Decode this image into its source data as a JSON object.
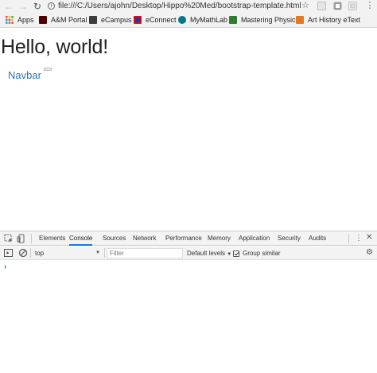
{
  "browser": {
    "url": "file:///C:/Users/ajohn/Desktop/Hippo%20Med/bootstrap-template.html",
    "bookmarks": [
      {
        "label": "Apps",
        "icon": "apps-grid-icon",
        "color": "#e94235"
      },
      {
        "label": "A&M Portal",
        "icon": "tamu-icon",
        "color": "#500000"
      },
      {
        "label": "eCampus",
        "icon": "ecampus-icon",
        "color": "#3c3c3c"
      },
      {
        "label": "eConnect",
        "icon": "econnect-icon",
        "color": "#c8102e"
      },
      {
        "label": "MyMathLab",
        "icon": "mymathlab-icon",
        "color": "#007a87"
      },
      {
        "label": "Mastering Physics",
        "icon": "mastering-icon",
        "color": "#2e7d32"
      },
      {
        "label": "Art History eText",
        "icon": "etext-icon",
        "color": "#e87722"
      }
    ]
  },
  "page": {
    "heading": "Hello, world!",
    "navbar_brand": "Navbar"
  },
  "devtools": {
    "tabs": [
      "Elements",
      "Console",
      "Sources",
      "Network",
      "Performance",
      "Memory",
      "Application",
      "Security",
      "Audits"
    ],
    "active_tab": "Console",
    "context": "top",
    "filter_placeholder": "Filter",
    "levels": "Default levels",
    "group_similar": "Group similar",
    "prompt": "›"
  },
  "colors": {
    "link": "#2a75bd",
    "active_tab_underline": "#1a73e8"
  }
}
